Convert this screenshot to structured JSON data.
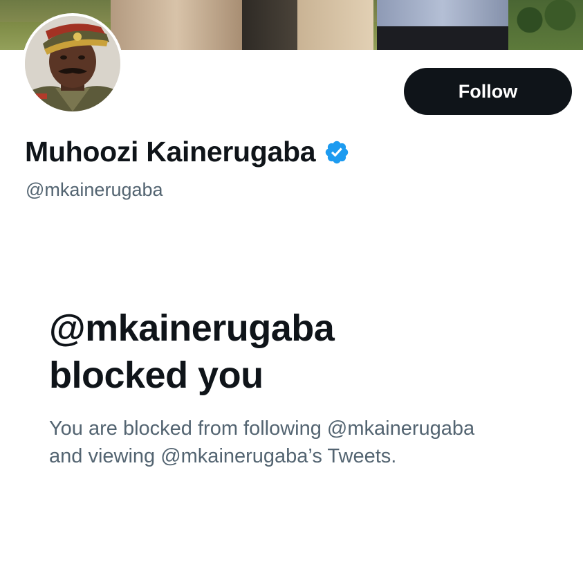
{
  "profile": {
    "display_name": "Muhoozi Kainerugaba",
    "handle": "@mkainerugaba",
    "verified": true
  },
  "actions": {
    "follow_label": "Follow"
  },
  "blocked": {
    "title_line1": "@mkainerugaba",
    "title_line2": "blocked you",
    "description_line1": "You are blocked from following @mkainerugaba",
    "description_line2": "and viewing @mkainerugaba’s Tweets."
  },
  "icons": {
    "verified": "verified-badge-icon"
  },
  "colors": {
    "text_primary": "#0f1419",
    "text_secondary": "#536471",
    "verified_blue": "#1d9bf0",
    "button_bg": "#0f1419",
    "button_text": "#ffffff"
  }
}
